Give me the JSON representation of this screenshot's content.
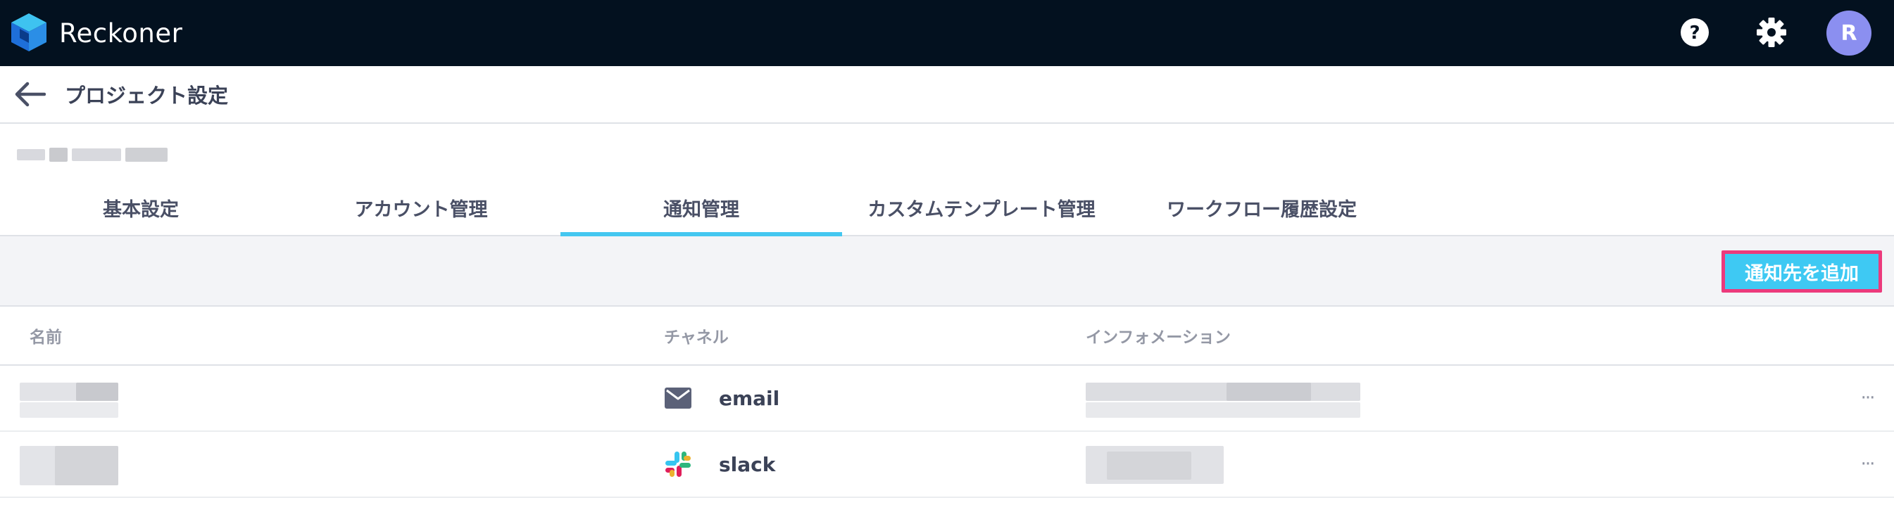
{
  "app": {
    "brand_name": "Reckoner",
    "user_initial": "R",
    "colors": {
      "topbar": "#03111f",
      "accent_tab": "#44c7f0",
      "primary_button": "#3ec9f3",
      "button_highlight_border": "#ec3a7c",
      "avatar": "#8b8ff0"
    }
  },
  "header": {
    "title": "プロジェクト設定"
  },
  "tabs": [
    {
      "label": "基本設定",
      "active": false
    },
    {
      "label": "アカウント管理",
      "active": false
    },
    {
      "label": "通知管理",
      "active": true
    },
    {
      "label": "カスタムテンプレート管理",
      "active": false
    },
    {
      "label": "ワークフロー履歴設定",
      "active": false
    }
  ],
  "toolbar": {
    "add_label": "通知先を追加"
  },
  "table": {
    "columns": [
      "名前",
      "チャネル",
      "インフォメーション"
    ],
    "rows": [
      {
        "channel": "email",
        "channel_icon": "envelope-icon"
      },
      {
        "channel": "slack",
        "channel_icon": "slack-icon"
      }
    ],
    "more_label": "···"
  }
}
